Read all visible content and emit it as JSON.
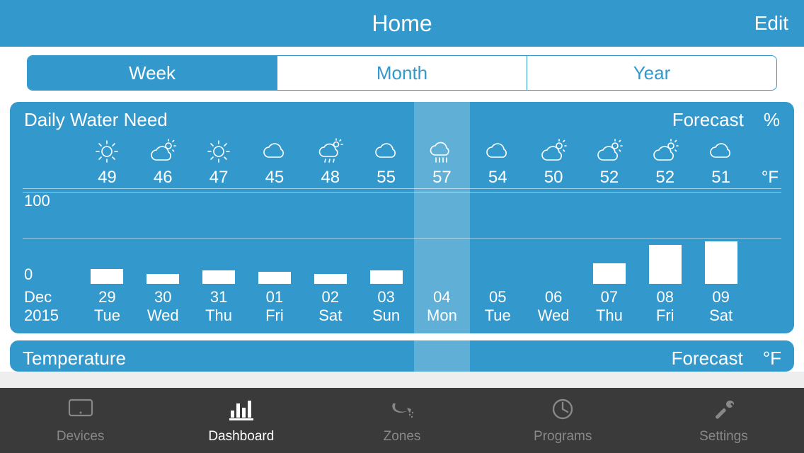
{
  "header": {
    "title": "Home",
    "edit": "Edit"
  },
  "segmented": {
    "items": [
      "Week",
      "Month",
      "Year"
    ],
    "active": 0
  },
  "card1": {
    "title": "Daily Water Need",
    "forecast_label": "Forecast",
    "percent_label": "%",
    "temp_unit": "°F",
    "y_labels": {
      "top": "100",
      "bottom": "0"
    },
    "lead_month": "Dec",
    "lead_year": "2015",
    "highlight_index": 6,
    "days": [
      {
        "icon": "sun",
        "temp": "49",
        "date": "29",
        "dow": "Tue",
        "bar": 16
      },
      {
        "icon": "partly",
        "temp": "46",
        "date": "30",
        "dow": "Wed",
        "bar": 11
      },
      {
        "icon": "sun",
        "temp": "47",
        "date": "31",
        "dow": "Thu",
        "bar": 15
      },
      {
        "icon": "cloud",
        "temp": "45",
        "date": "01",
        "dow": "Fri",
        "bar": 13
      },
      {
        "icon": "partly-rain",
        "temp": "48",
        "date": "02",
        "dow": "Sat",
        "bar": 11
      },
      {
        "icon": "cloud",
        "temp": "55",
        "date": "03",
        "dow": "Sun",
        "bar": 15
      },
      {
        "icon": "rain",
        "temp": "57",
        "date": "04",
        "dow": "Mon",
        "bar": 0
      },
      {
        "icon": "cloud",
        "temp": "54",
        "date": "05",
        "dow": "Tue",
        "bar": 0
      },
      {
        "icon": "partly",
        "temp": "50",
        "date": "06",
        "dow": "Wed",
        "bar": 0
      },
      {
        "icon": "partly",
        "temp": "52",
        "date": "07",
        "dow": "Thu",
        "bar": 22
      },
      {
        "icon": "partly",
        "temp": "52",
        "date": "08",
        "dow": "Fri",
        "bar": 42
      },
      {
        "icon": "cloud",
        "temp": "51",
        "date": "09",
        "dow": "Sat",
        "bar": 46
      }
    ]
  },
  "card2": {
    "title": "Temperature",
    "forecast_label": "Forecast",
    "unit": "°F"
  },
  "tabs": {
    "items": [
      {
        "name": "devices",
        "label": "Devices"
      },
      {
        "name": "dashboard",
        "label": "Dashboard"
      },
      {
        "name": "zones",
        "label": "Zones"
      },
      {
        "name": "programs",
        "label": "Programs"
      },
      {
        "name": "settings",
        "label": "Settings"
      }
    ],
    "active": 1
  },
  "chart_data": {
    "type": "bar",
    "title": "Daily Water Need",
    "ylabel": "%",
    "ylim": [
      0,
      100
    ],
    "categories": [
      "29",
      "30",
      "31",
      "01",
      "02",
      "03",
      "04",
      "05",
      "06",
      "07",
      "08",
      "09"
    ],
    "values": [
      16,
      11,
      15,
      13,
      11,
      15,
      0,
      0,
      0,
      22,
      42,
      46
    ]
  }
}
